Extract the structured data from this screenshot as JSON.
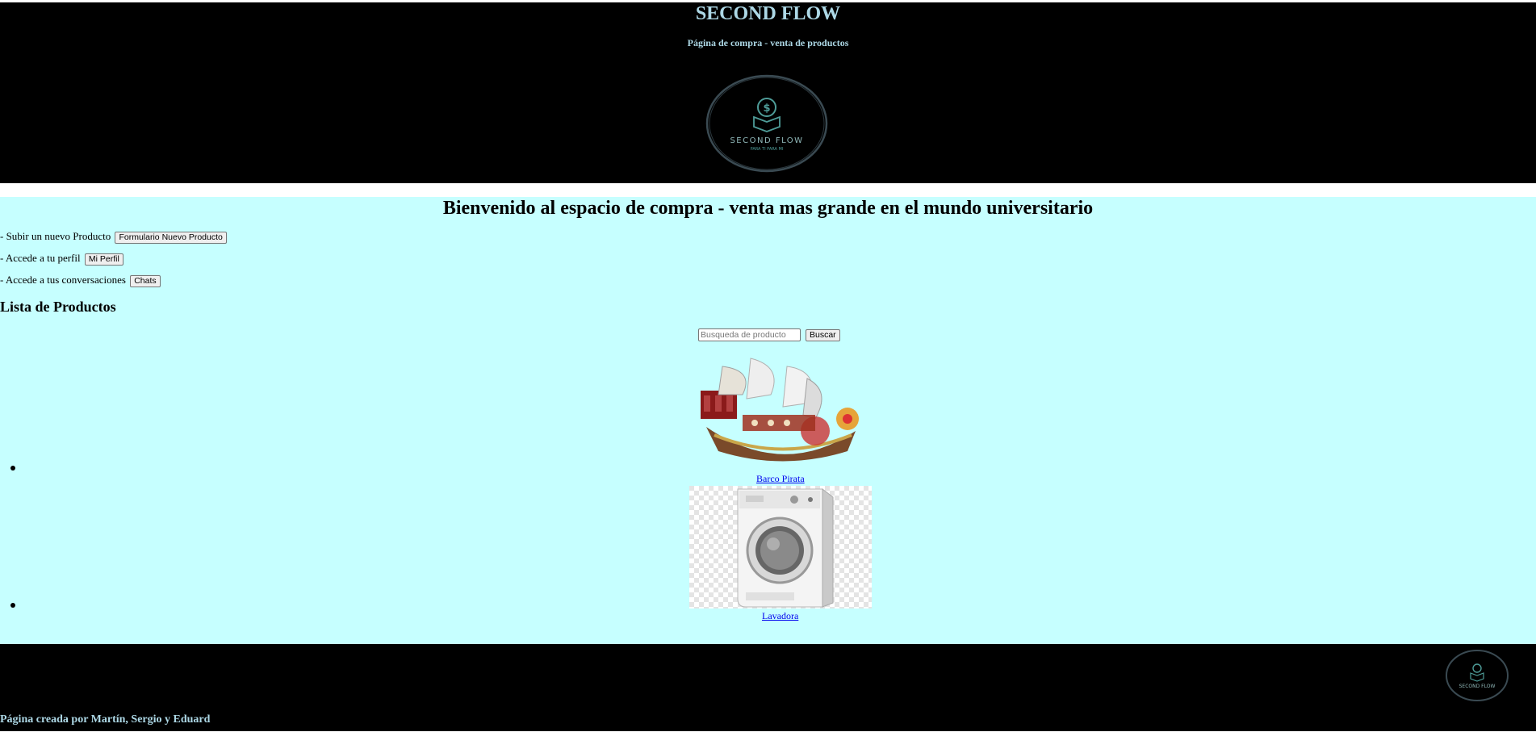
{
  "header": {
    "title": "SECOND FLOW",
    "subtitle": "Página de compra - venta de productos",
    "logo_text": "SECOND FLOW",
    "logo_tagline": "PARA TI PARA MI"
  },
  "main": {
    "welcome": "Bienvenido al espacio de compra - venta mas grande en el mundo universitario",
    "actions": [
      {
        "label": "- Subir un nuevo Producto",
        "button": "Formulario Nuevo Producto"
      },
      {
        "label": "- Accede a tu perfil",
        "button": "Mi Perfil"
      },
      {
        "label": "- Accede a tus conversaciones",
        "button": "Chats"
      }
    ],
    "list_title": "Lista de Productos",
    "search": {
      "placeholder": "Busqueda de producto",
      "value": "",
      "button": "Buscar"
    },
    "products": [
      {
        "name": "Barco Pirata",
        "image": "pirate-ship-image"
      },
      {
        "name": "Lavadora",
        "image": "washing-machine-image"
      }
    ]
  },
  "footer": {
    "credit": "Página creada por Martín, Sergio y Eduard",
    "logo_text": "SECOND FLOW"
  },
  "colors": {
    "header_bg": "#000000",
    "title_color": "#add8e6",
    "main_bg": "#c6ffff",
    "link_color": "#0000ee"
  }
}
